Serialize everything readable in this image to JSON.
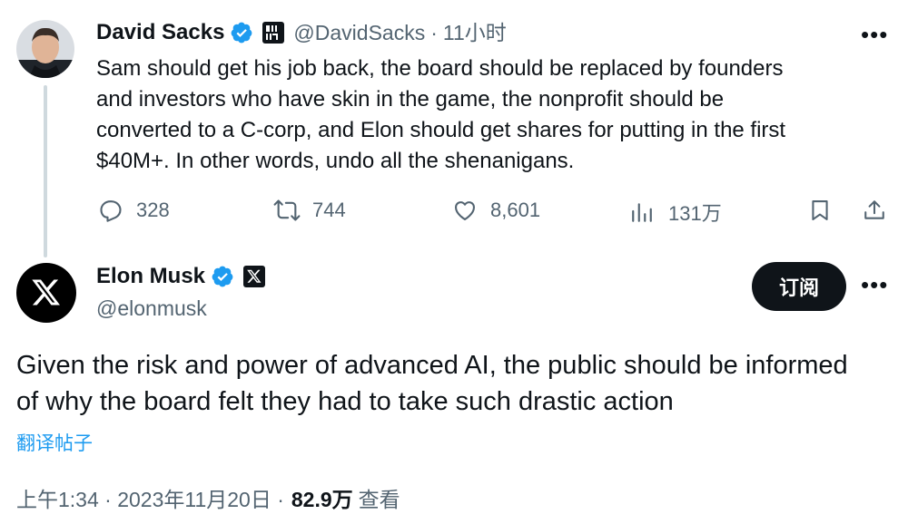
{
  "parent_tweet": {
    "author_name": "David Sacks",
    "affiliate_badge": "ALL IN",
    "handle": "@DavidSacks",
    "separator": "·",
    "time": "11小时",
    "text": "Sam should get his job back, the board should be replaced by founders\nand investors who have skin in the game, the nonprofit should be\nconverted to a C-corp, and Elon should get shares for putting in the first\n$40M+. In other words, undo all the shenanigans.",
    "more_label": "•••",
    "actions": {
      "replies": "328",
      "reposts": "744",
      "likes": "8,601",
      "views": "131万"
    }
  },
  "main_tweet": {
    "author_name": "Elon Musk",
    "handle": "@elonmusk",
    "subscribe_label": "订阅",
    "more_label": "•••",
    "text": "Given the risk and power of advanced AI, the public should be informed\nof why the board felt they had to take such drastic action",
    "translate_label": "翻译帖子",
    "timestamp": "上午1:34 · 2023年11月20日 ·",
    "views_count": "82.9万",
    "views_label": "查看"
  },
  "colors": {
    "text": "#0f1419",
    "muted": "#536471",
    "verified": "#1d9bf0",
    "link": "#1d9bf0",
    "thread_line": "#cfd9de"
  },
  "icons": [
    "verified-icon",
    "all-in-badge-icon",
    "x-badge-icon",
    "reply-icon",
    "repost-icon",
    "like-icon",
    "views-icon",
    "bookmark-icon",
    "share-icon",
    "more-icon",
    "x-logo-icon"
  ]
}
